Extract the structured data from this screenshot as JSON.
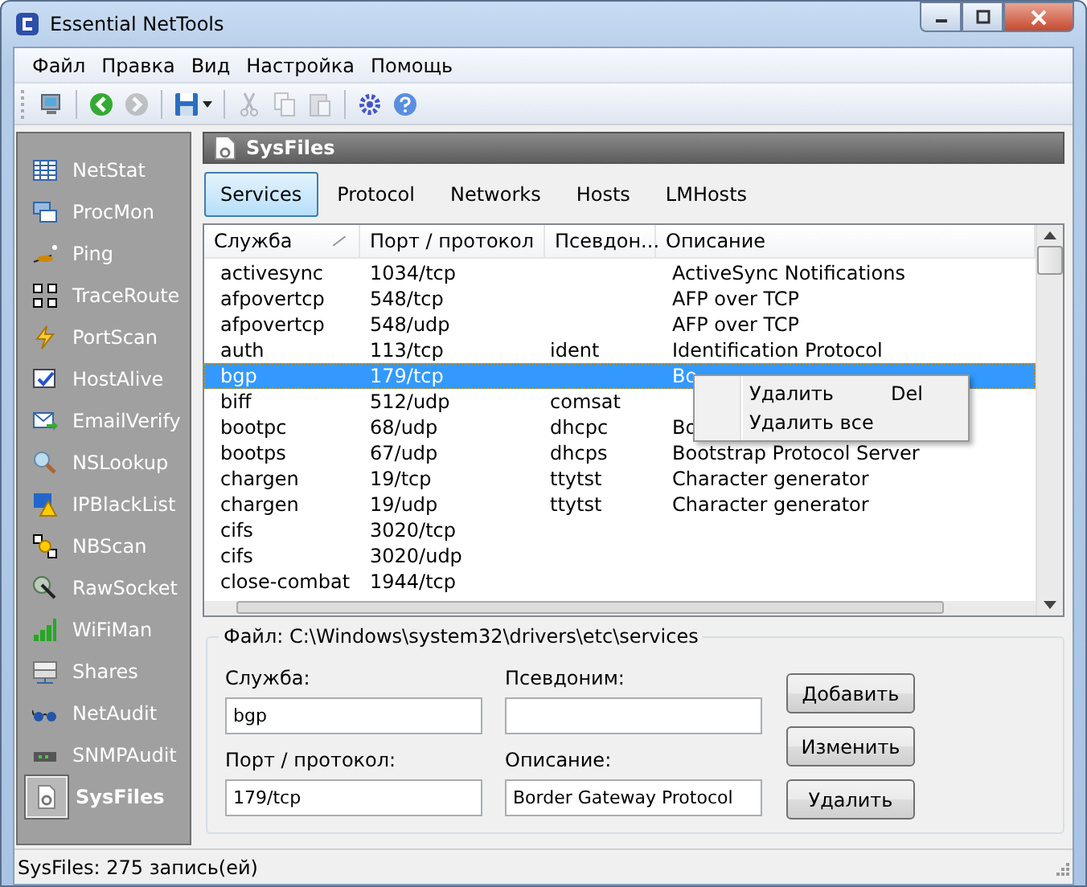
{
  "window": {
    "title": "Essential NetTools"
  },
  "menu": [
    "Файл",
    "Правка",
    "Вид",
    "Настройка",
    "Помощь"
  ],
  "toolbar": [
    {
      "kind": "computer",
      "disabled": false
    },
    {
      "kind": "back",
      "disabled": false
    },
    {
      "kind": "forward",
      "disabled": true
    },
    {
      "kind": "save",
      "disabled": false
    },
    {
      "kind": "cut",
      "disabled": true
    },
    {
      "kind": "copy",
      "disabled": true
    },
    {
      "kind": "paste",
      "disabled": true
    },
    {
      "kind": "settings",
      "disabled": false
    },
    {
      "kind": "help",
      "disabled": false
    }
  ],
  "sidebar": {
    "items": [
      {
        "label": "NetStat",
        "selected": false
      },
      {
        "label": "ProcMon",
        "selected": false
      },
      {
        "label": "Ping",
        "selected": false
      },
      {
        "label": "TraceRoute",
        "selected": false
      },
      {
        "label": "PortScan",
        "selected": false
      },
      {
        "label": "HostAlive",
        "selected": false
      },
      {
        "label": "EmailVerify",
        "selected": false
      },
      {
        "label": "NSLookup",
        "selected": false
      },
      {
        "label": "IPBlackList",
        "selected": false
      },
      {
        "label": "NBScan",
        "selected": false
      },
      {
        "label": "RawSocket",
        "selected": false
      },
      {
        "label": "WiFiMan",
        "selected": false
      },
      {
        "label": "Shares",
        "selected": false
      },
      {
        "label": "NetAudit",
        "selected": false
      },
      {
        "label": "SNMPAudit",
        "selected": false
      },
      {
        "label": "SysFiles",
        "selected": true
      }
    ]
  },
  "panel": {
    "title": "SysFiles"
  },
  "tabs": [
    {
      "label": "Services",
      "selected": true
    },
    {
      "label": "Protocol",
      "selected": false
    },
    {
      "label": "Networks",
      "selected": false
    },
    {
      "label": "Hosts",
      "selected": false
    },
    {
      "label": "LMHosts",
      "selected": false
    }
  ],
  "table": {
    "columns": [
      {
        "label": "Служба",
        "sorted": true
      },
      {
        "label": "Порт / протокол",
        "sorted": false
      },
      {
        "label": "Псевдон...",
        "sorted": false
      },
      {
        "label": "Описание",
        "sorted": false
      }
    ],
    "rows": [
      {
        "cells": [
          "activesync",
          "1034/tcp",
          "",
          "ActiveSync Notifications"
        ],
        "selected": false
      },
      {
        "cells": [
          "afpovertcp",
          "548/tcp",
          "",
          "AFP over TCP"
        ],
        "selected": false
      },
      {
        "cells": [
          "afpovertcp",
          "548/udp",
          "",
          "AFP over TCP"
        ],
        "selected": false
      },
      {
        "cells": [
          "auth",
          "113/tcp",
          "ident",
          "Identification Protocol"
        ],
        "selected": false
      },
      {
        "cells": [
          "bgp",
          "179/tcp",
          "",
          "Bo"
        ],
        "selected": true
      },
      {
        "cells": [
          "biff",
          "512/udp",
          "comsat",
          ""
        ],
        "selected": false
      },
      {
        "cells": [
          "bootpc",
          "68/udp",
          "dhcpc",
          "Bo"
        ],
        "selected": false
      },
      {
        "cells": [
          "bootps",
          "67/udp",
          "dhcps",
          "Bootstrap Protocol Server"
        ],
        "selected": false
      },
      {
        "cells": [
          "chargen",
          "19/tcp",
          "ttytst",
          "Character generator"
        ],
        "selected": false
      },
      {
        "cells": [
          "chargen",
          "19/udp",
          "ttytst",
          "Character generator"
        ],
        "selected": false
      },
      {
        "cells": [
          "cifs",
          "3020/tcp",
          "",
          ""
        ],
        "selected": false
      },
      {
        "cells": [
          "cifs",
          "3020/udp",
          "",
          ""
        ],
        "selected": false
      },
      {
        "cells": [
          "close-combat",
          "1944/tcp",
          "",
          ""
        ],
        "selected": false
      }
    ]
  },
  "context_menu": [
    {
      "label": "Удалить",
      "shortcut": "Del"
    },
    {
      "label": "Удалить все"
    }
  ],
  "details": {
    "title": "Файл: C:\\Windows\\system32\\drivers\\etc\\services",
    "fields": [
      {
        "label": "Служба:",
        "value": "bgp"
      },
      {
        "label": "Псевдоним:"
      },
      {
        "label": "Порт / протокол:",
        "value": "179/tcp"
      },
      {
        "label": "Описание:",
        "value": "Border Gateway Protocol"
      }
    ],
    "buttons": [
      "Добавить",
      "Изменить",
      "Удалить"
    ]
  },
  "status_bar": "SysFiles: 275 запись(ей)"
}
